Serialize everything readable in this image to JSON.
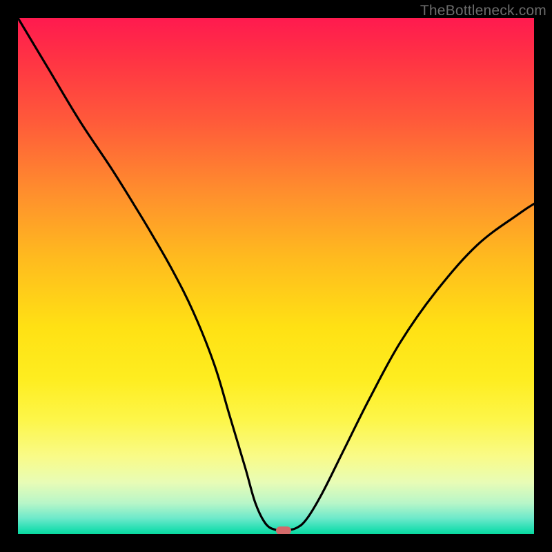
{
  "watermark": "TheBottleneck.com",
  "marker": {
    "x_pct": 51.5,
    "y_pct": 99.3
  },
  "chart_data": {
    "type": "line",
    "title": "",
    "xlabel": "",
    "ylabel": "",
    "xlim": [
      0,
      100
    ],
    "ylim": [
      0,
      100
    ],
    "series": [
      {
        "name": "bottleneck-curve",
        "x": [
          0,
          6,
          12,
          18,
          23,
          26,
          30,
          34,
          38,
          41,
          44,
          46,
          48,
          50,
          52,
          54,
          56,
          59,
          63,
          68,
          74,
          81,
          89,
          97,
          100
        ],
        "y": [
          100,
          90,
          80,
          71,
          63,
          58,
          51,
          43,
          33,
          23,
          13,
          6,
          2,
          0.8,
          0.8,
          1.2,
          3,
          8,
          16,
          26,
          37,
          47,
          56,
          62,
          64
        ]
      }
    ],
    "annotations": [
      {
        "type": "marker",
        "x": 51.5,
        "y": 0.7,
        "label": "optimal-point"
      }
    ],
    "background_gradient": {
      "top": "#ff1a4f",
      "mid": "#ffe114",
      "bottom": "#08d99e"
    }
  }
}
